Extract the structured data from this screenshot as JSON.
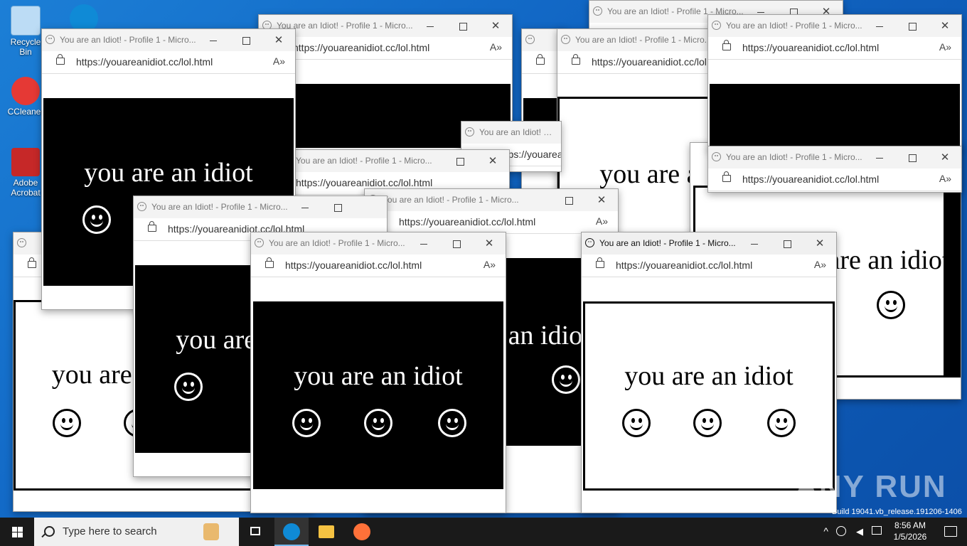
{
  "desktop": {
    "icons": [
      {
        "label": "Recycle Bin",
        "color": "#9fd0ff"
      },
      {
        "label": "CCleaner",
        "color": "#e53935"
      },
      {
        "label": "Adobe Acrobat",
        "color": "#d32f2f"
      }
    ]
  },
  "browser": {
    "title": "You are an Idiot! - Profile 1 - Micro...",
    "url": "https://youareanidiot.cc/lol.html",
    "message": "you are an idiot",
    "read_aloud": "A»"
  },
  "taskbar": {
    "search_placeholder": "Type here to search",
    "time": "8:56 AM",
    "date": "1/5/2026"
  },
  "watermark": "ANY RUN",
  "build_text": "Build 19041.vb_release.191206-1406",
  "colors": {
    "accent": "#0078d7",
    "taskbar": "#1a1a1a",
    "edge": "#0f8ad6"
  }
}
